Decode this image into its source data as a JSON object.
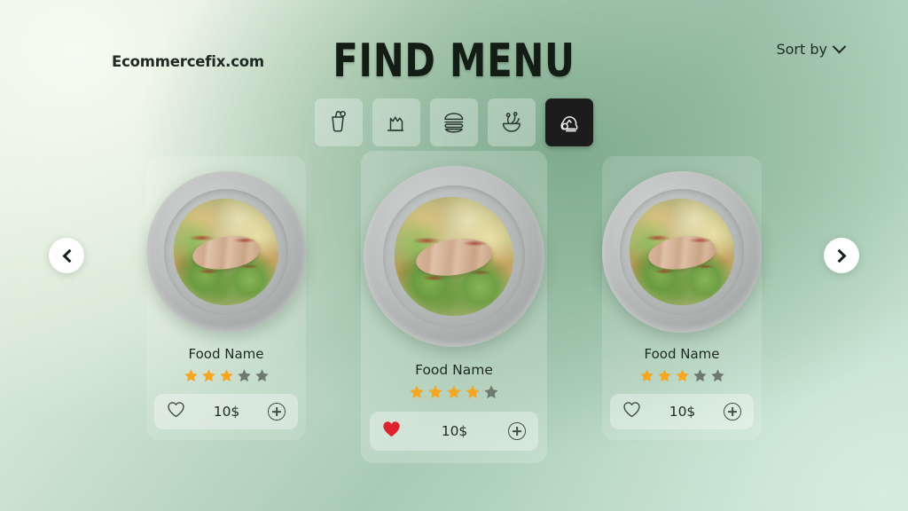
{
  "header": {
    "brand": "Ecommercefix.com",
    "title": "FIND MENU",
    "sort_label": "Sort by",
    "sort_icon": "chevron-down-icon"
  },
  "categories": {
    "items": [
      {
        "id": "drinks",
        "icon": "drink-glass-icon",
        "label": "Drinks",
        "selected": false
      },
      {
        "id": "desserts",
        "icon": "cake-slice-icon",
        "label": "Desserts",
        "selected": false
      },
      {
        "id": "burgers",
        "icon": "burger-icon",
        "label": "Burgers",
        "selected": false
      },
      {
        "id": "salads",
        "icon": "salad-bowl-icon",
        "label": "Salads",
        "selected": false
      },
      {
        "id": "grill",
        "icon": "grilled-food-icon",
        "label": "Grill",
        "selected": true
      }
    ]
  },
  "carousel": {
    "prev_icon": "chevron-left-icon",
    "next_icon": "chevron-right-icon",
    "cards": [
      {
        "title": "Food Name",
        "rating_filled": 3,
        "rating_total": 5,
        "price": "10$",
        "favorited": false,
        "heart_icon": "heart-outline-icon",
        "add_icon": "plus-circle-icon",
        "featured": false,
        "image_alt": "chicken-caesar-salad-on-plate"
      },
      {
        "title": "Food Name",
        "rating_filled": 4,
        "rating_total": 5,
        "price": "10$",
        "favorited": true,
        "heart_icon": "heart-filled-icon",
        "add_icon": "plus-circle-icon",
        "featured": true,
        "image_alt": "chicken-caesar-salad-on-plate"
      },
      {
        "title": "Food Name",
        "rating_filled": 3,
        "rating_total": 5,
        "price": "10$",
        "favorited": false,
        "heart_icon": "heart-outline-icon",
        "add_icon": "plus-circle-icon",
        "featured": false,
        "image_alt": "chicken-caesar-salad-on-plate"
      }
    ]
  },
  "colors": {
    "star_filled": "#f5a623",
    "star_empty": "#6e7a70",
    "heart_filled": "#e0222c",
    "heart_outline": "#3d4b40",
    "title_text": "#141c16",
    "tab_active_bg": "#1c1c1c",
    "background_top_left": "#eef5e9",
    "background_top_right": "#9cc4a8",
    "background_bottom_right": "#d2ecdd"
  }
}
